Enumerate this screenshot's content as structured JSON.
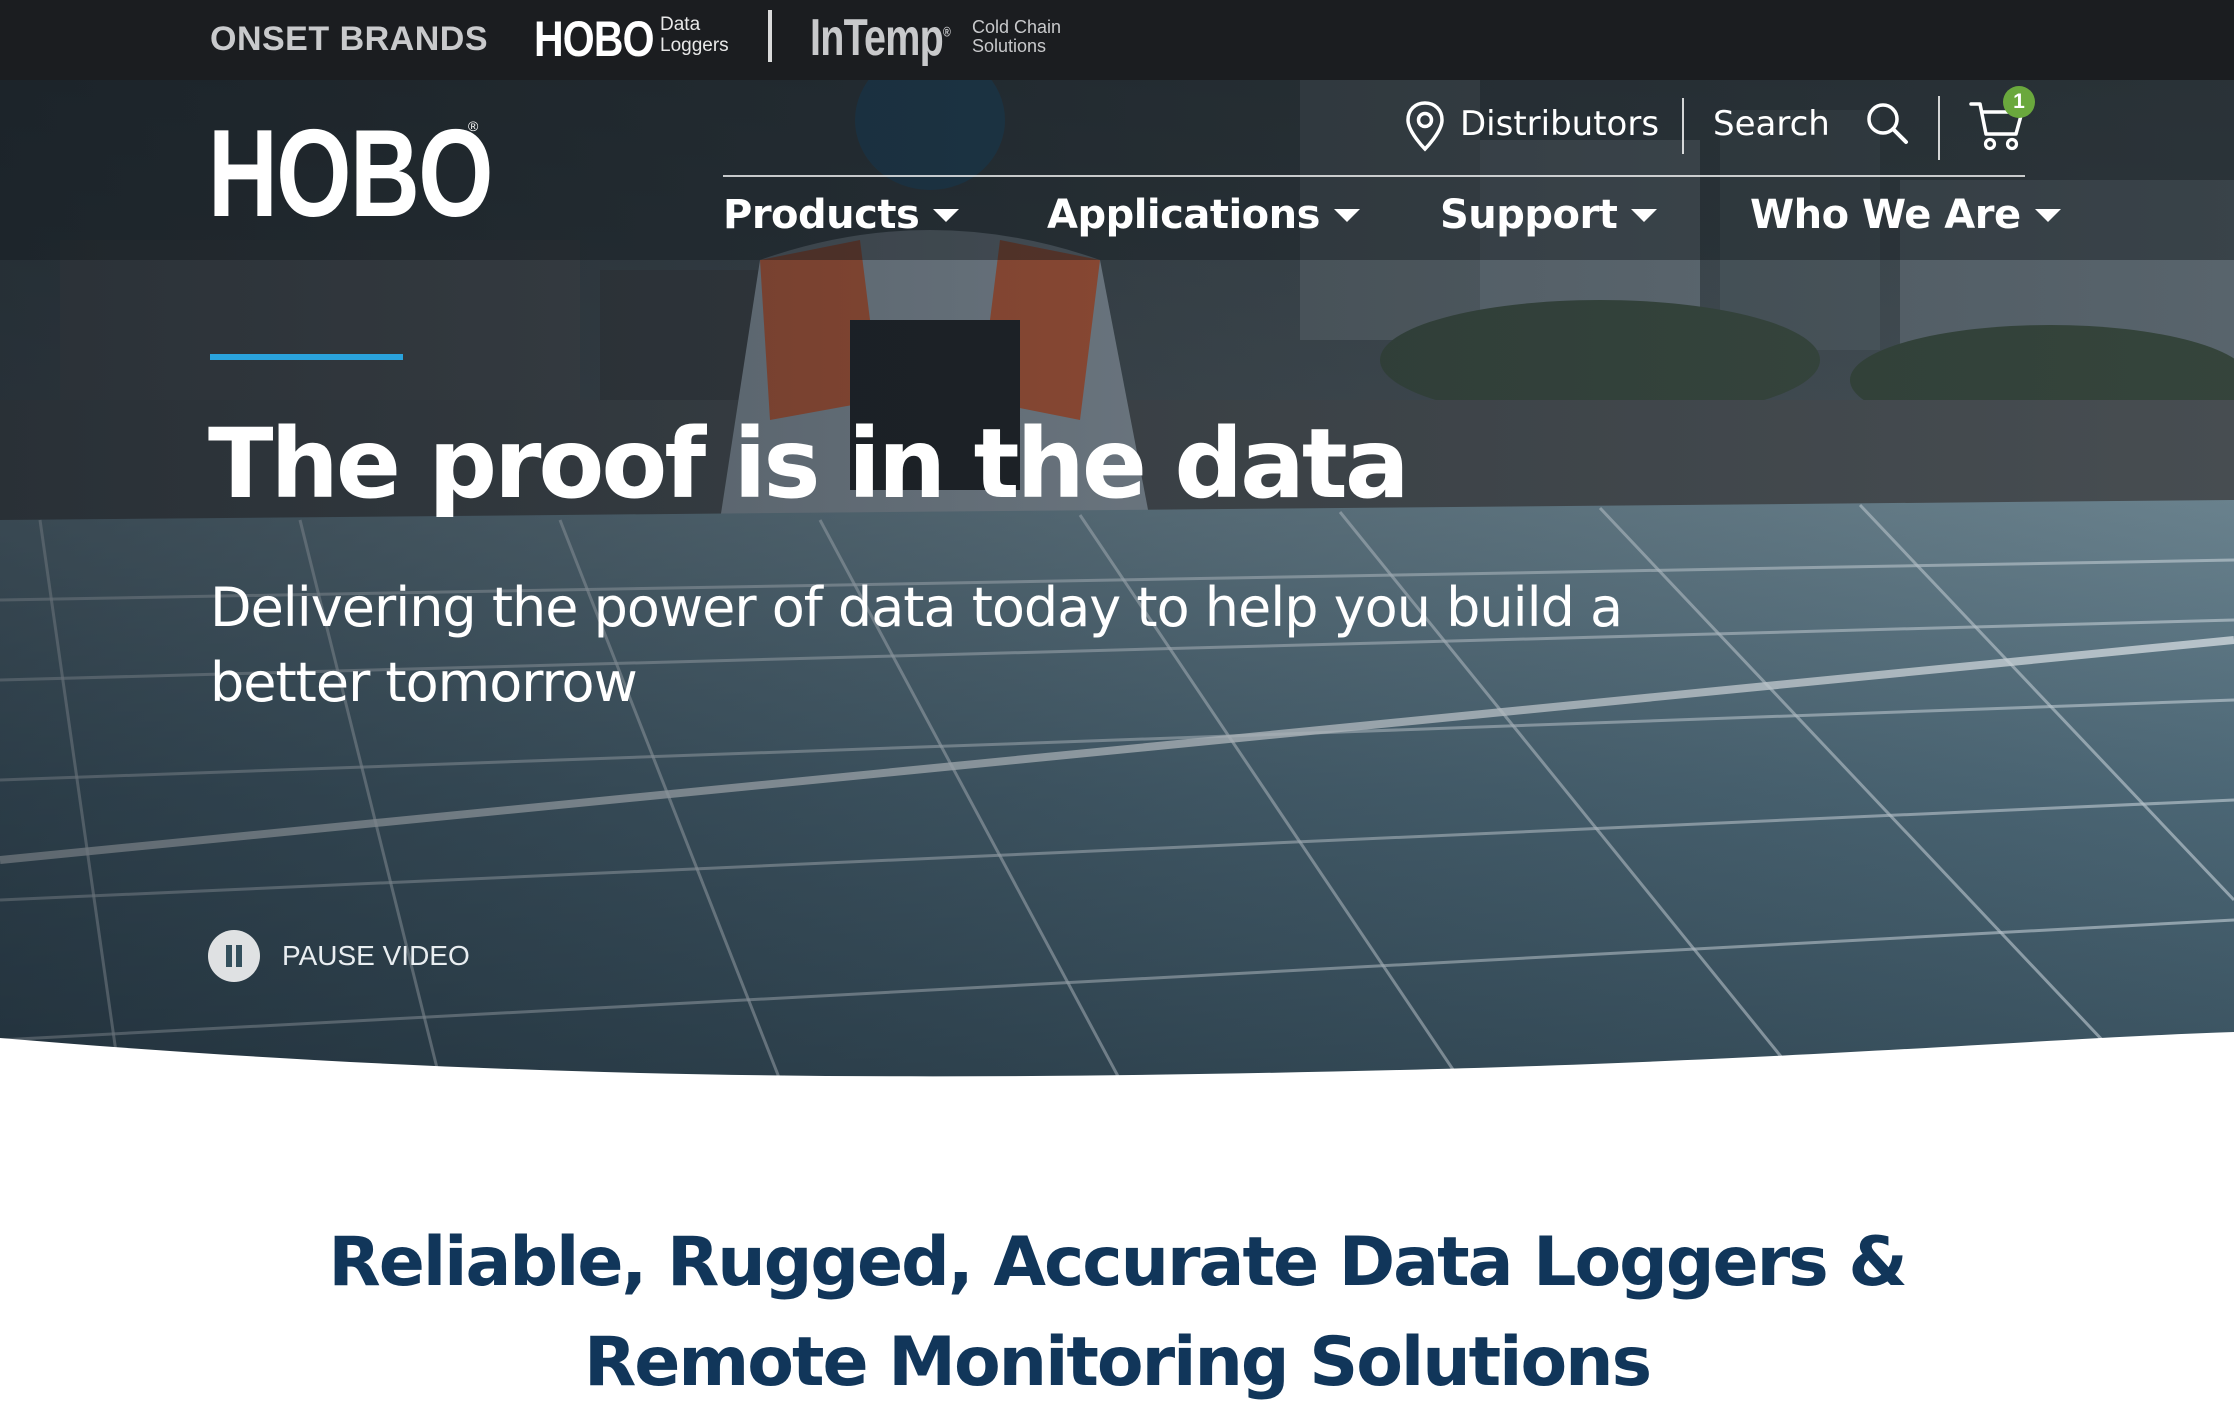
{
  "brands": {
    "onset": "ONSET BRANDS",
    "hobo": "HOBO",
    "hobo_sub_1": "Data",
    "hobo_sub_2": "Loggers",
    "intemp": "InTemp",
    "intemp_reg": "®",
    "intemp_sub_1": "Cold Chain",
    "intemp_sub_2": "Solutions"
  },
  "header": {
    "logo": "HOBO",
    "logo_reg": "®",
    "distributors": "Distributors",
    "search": "Search",
    "cart_count": "1"
  },
  "nav": {
    "items": [
      {
        "label": "Products"
      },
      {
        "label": "Applications"
      },
      {
        "label": "Support"
      },
      {
        "label": "Who We Are"
      }
    ]
  },
  "hero": {
    "title": "The proof is in the data",
    "subtitle": "Delivering the power of data today to help you build a better tomorrow",
    "pause_label": "PAUSE VIDEO"
  },
  "content": {
    "heading": "Reliable, Rugged, Accurate Data Loggers & Remote Monitoring Solutions"
  },
  "colors": {
    "accent": "#2aa3dd",
    "heading": "#11365a",
    "badge": "#6aa83d"
  },
  "icons": [
    "location-pin-icon",
    "search-icon",
    "cart-icon",
    "pause-icon",
    "chevron-down-icon"
  ]
}
